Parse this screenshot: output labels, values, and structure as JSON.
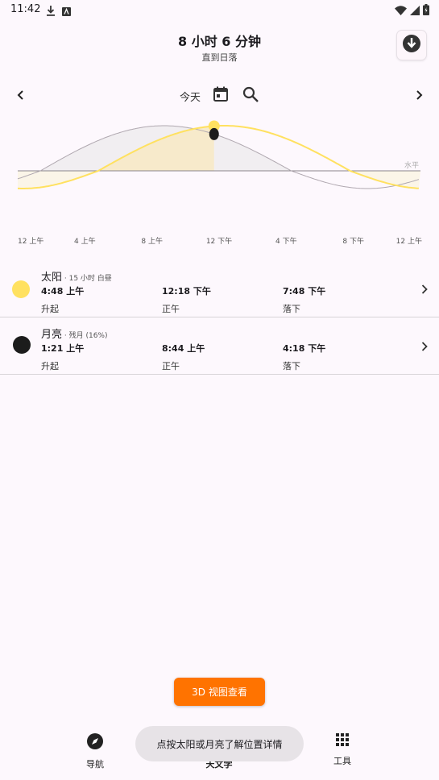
{
  "status_bar": {
    "time": "11:42"
  },
  "header": {
    "title": "8 小时 6 分钟",
    "subtitle": "直到日落"
  },
  "nav": {
    "today_label": "今天"
  },
  "chart_data": {
    "type": "line",
    "x_tick_labels": [
      "12 上午",
      "4 上午",
      "8 上午",
      "12 下午",
      "4 下午",
      "8 下午",
      "12 上午"
    ],
    "horizon_label": "水平",
    "x_range_hours": [
      0,
      24
    ],
    "current_hour": 11.7,
    "series": [
      {
        "name": "",
        "color": "#FFE160",
        "rise": 4.8,
        "set": 19.8,
        "peak_hour": 12.3
      },
      {
        "name": "",
        "color": "#B0A8B0",
        "rise": 1.35,
        "set": 16.3,
        "peak_hour": 8.7
      }
    ],
    "grid": false
  },
  "rows": [
    {
      "name": "太阳",
      "sub": " · 15 小时 白昼",
      "icon_color": "#FFE160",
      "events": [
        {
          "time": "4:48 上午",
          "label": "升起"
        },
        {
          "time": "12:18 下午",
          "label": "正午"
        },
        {
          "time": "7:48 下午",
          "label": "落下"
        }
      ]
    },
    {
      "name": "月亮",
      "sub": " · 残月 (16%)",
      "icon_color": "#1c1c1c",
      "events": [
        {
          "time": "1:21 上午",
          "label": "升起"
        },
        {
          "time": "8:44 上午",
          "label": "正午"
        },
        {
          "time": "4:18 下午",
          "label": "落下"
        }
      ]
    }
  ],
  "buttons": {
    "view_3d": "3D 视图查看"
  },
  "bottom_nav": [
    {
      "label": "导航",
      "icon": "compass-icon"
    },
    {
      "label": "天文学",
      "icon": "astronomy-icon"
    },
    {
      "label": "工具",
      "icon": "grid-icon"
    }
  ],
  "toast": "点按太阳或月亮了解位置详情"
}
